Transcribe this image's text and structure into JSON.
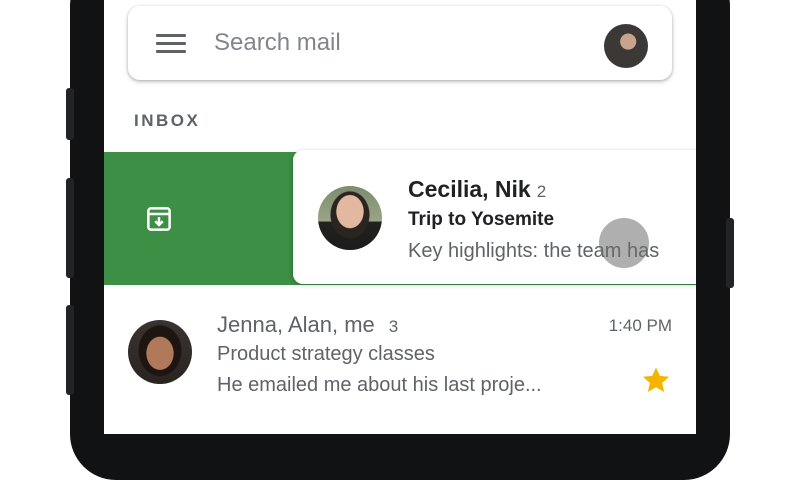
{
  "search": {
    "placeholder": "Search mail"
  },
  "section": {
    "label": "INBOX"
  },
  "swiped_email": {
    "sender": "Cecilia, Nik",
    "count": "2",
    "subject": "Trip to Yosemite",
    "snippet": "Key highlights: the team has"
  },
  "email": {
    "sender": "Jenna, Alan, me",
    "count": "3",
    "time": "1:40 PM",
    "subject": "Product strategy classes",
    "snippet": "He emailed me about his last proje..."
  },
  "colors": {
    "archive_swipe_green": "#3c8f45",
    "star_yellow": "#f4b400",
    "text_secondary": "#5f6368",
    "text_primary": "#202124"
  },
  "icons": [
    "menu-icon",
    "account-avatar",
    "archive-icon",
    "star-icon"
  ]
}
